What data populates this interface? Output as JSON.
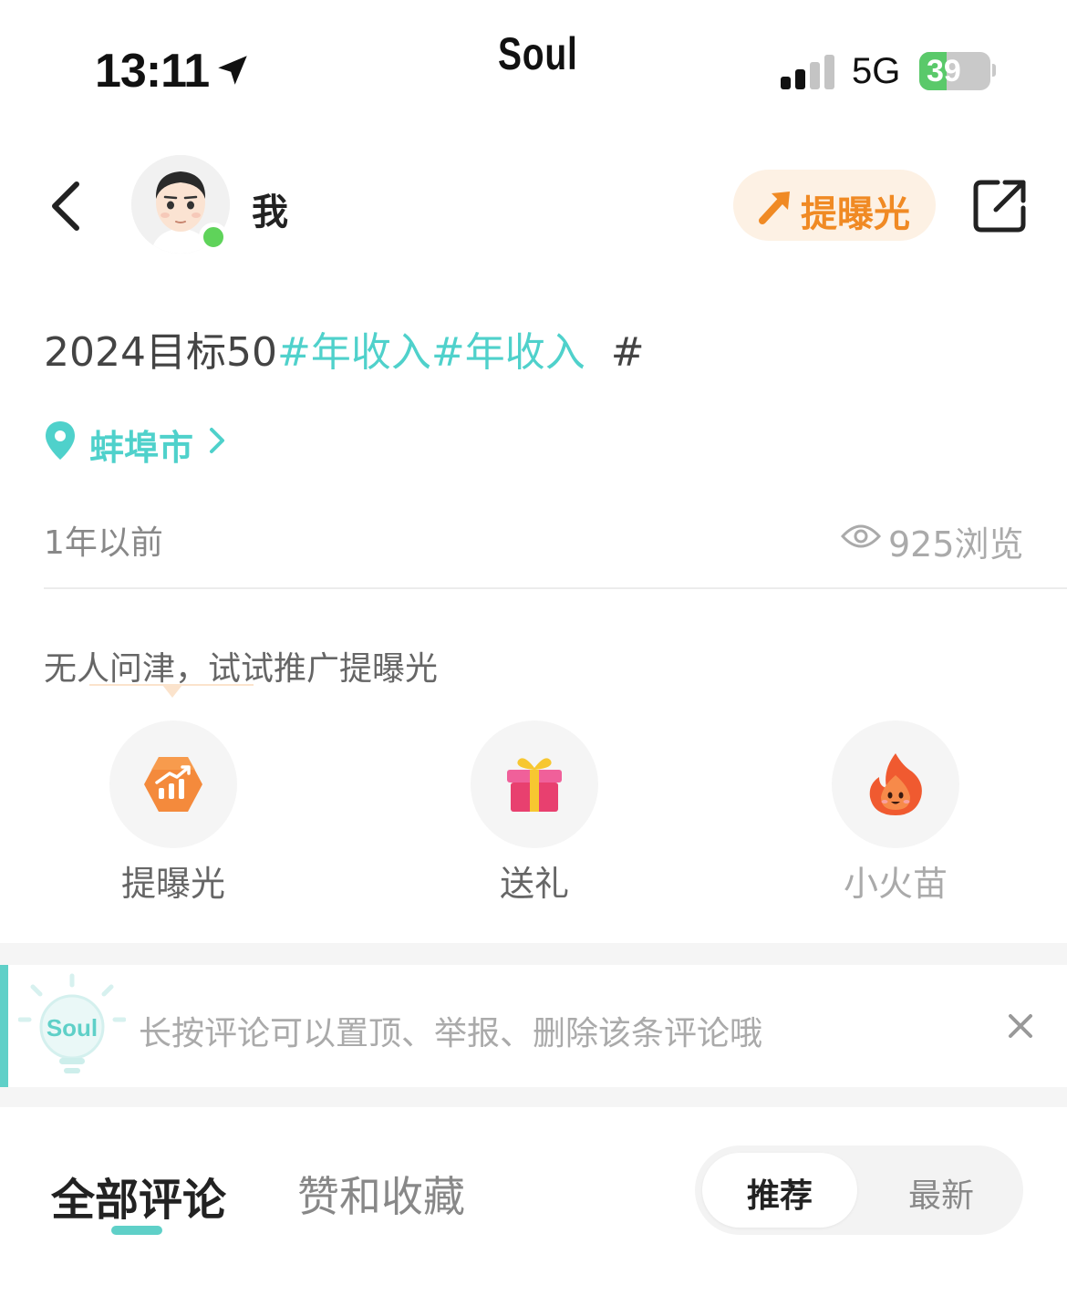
{
  "status_bar": {
    "time": "13:11",
    "app_name": "Soul",
    "network": "5G",
    "battery": "39",
    "battery_level": 0.39
  },
  "header": {
    "username": "我",
    "boost_label": "提曝光"
  },
  "post": {
    "text_plain": "2024目标50",
    "tag1": "#年收入",
    "tag2": "#年收入",
    "trailing": "  #",
    "location": "蚌埠市",
    "time_ago": "1年以前",
    "views": "925浏览"
  },
  "promo": {
    "prompt": "无人问津，试试推广提曝光",
    "actions": [
      {
        "label": "提曝光",
        "icon": "chart-up-icon"
      },
      {
        "label": "送礼",
        "icon": "gift-icon"
      },
      {
        "label": "小火苗",
        "icon": "flame-icon"
      }
    ]
  },
  "tip": {
    "text": "长按评论可以置顶、举报、删除该条评论哦",
    "bulb_label": "Soul"
  },
  "tabs": {
    "all_comments": "全部评论",
    "likes_favorites": "赞和收藏",
    "sort_recommended": "推荐",
    "sort_latest": "最新"
  },
  "colors": {
    "accent_teal": "#4fd1cb",
    "boost_orange": "#f08a24",
    "online_green": "#5fd35a"
  }
}
